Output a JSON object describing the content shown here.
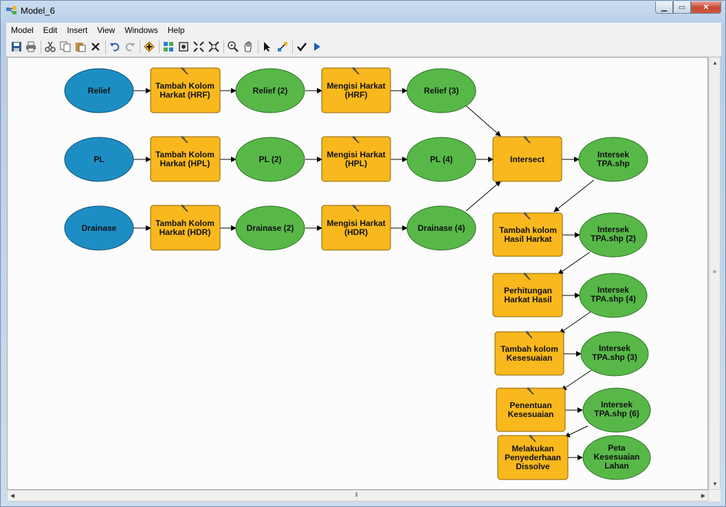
{
  "window": {
    "title": "Model_6"
  },
  "menu": [
    "Model",
    "Edit",
    "Insert",
    "View",
    "Windows",
    "Help"
  ],
  "toolbar_icons": [
    "save-icon",
    "print-icon",
    "cut-icon",
    "copy-icon",
    "paste-icon",
    "delete-icon",
    "undo-icon",
    "redo-icon",
    "add-data-icon",
    "auto-layout-icon",
    "full-extent-icon",
    "zoom-in-fixed-icon",
    "zoom-out-fixed-icon",
    "zoom-in-icon",
    "pan-icon",
    "select-icon",
    "connect-icon",
    "validate-icon",
    "run-icon"
  ],
  "colors": {
    "input": "#1d8ec4",
    "tool": "#f9b81d",
    "output": "#57b848"
  },
  "nodes": {
    "relief": "Relief",
    "pl": "PL",
    "drainase": "Drainase",
    "tambah_hrf": [
      "Tambah Kolom",
      "Harkat (HRF)"
    ],
    "tambah_hpl": [
      "Tambah Kolom",
      "Harkat (HPL)"
    ],
    "tambah_hdr": [
      "Tambah Kolom",
      "Harkat (HDR)"
    ],
    "relief2": "Relief (2)",
    "pl2": "PL (2)",
    "drainase2": "Drainase (2)",
    "mengisi_hrf": [
      "Mengisi Harkat",
      "(HRF)"
    ],
    "mengisi_hpl": [
      "Mengisi Harkat",
      "(HPL)"
    ],
    "mengisi_hdr": [
      "Mengisi Harkat",
      "(HDR)"
    ],
    "relief3": "Relief (3)",
    "pl4": "PL (4)",
    "drainase4": "Drainase (4)",
    "intersect": "Intersect",
    "intersek1": [
      "Intersek",
      "TPA.shp"
    ],
    "tambah_hasil": [
      "Tambah kolom",
      "Hasil Harkat"
    ],
    "intersek2": [
      "Intersek",
      "TPA.shp (2)"
    ],
    "perhitungan": [
      "Perhitungan",
      "Harkat Hasil"
    ],
    "intersek4": [
      "Intersek",
      "TPA.shp (4)"
    ],
    "tambah_kesesuaian": [
      "Tambah kolom",
      "Kesesuaian"
    ],
    "intersek3": [
      "Intersek",
      "TPA.shp (3)"
    ],
    "penentuan": [
      "Penentuan",
      "Kesesuaian"
    ],
    "intersek6": [
      "Intersek",
      "TPA.shp (6)"
    ],
    "melakukan": [
      "Melakukan",
      "Penyederhaan",
      "Dissolve"
    ],
    "peta": [
      "Peta",
      "Kesesuaian",
      "Lahan"
    ]
  }
}
